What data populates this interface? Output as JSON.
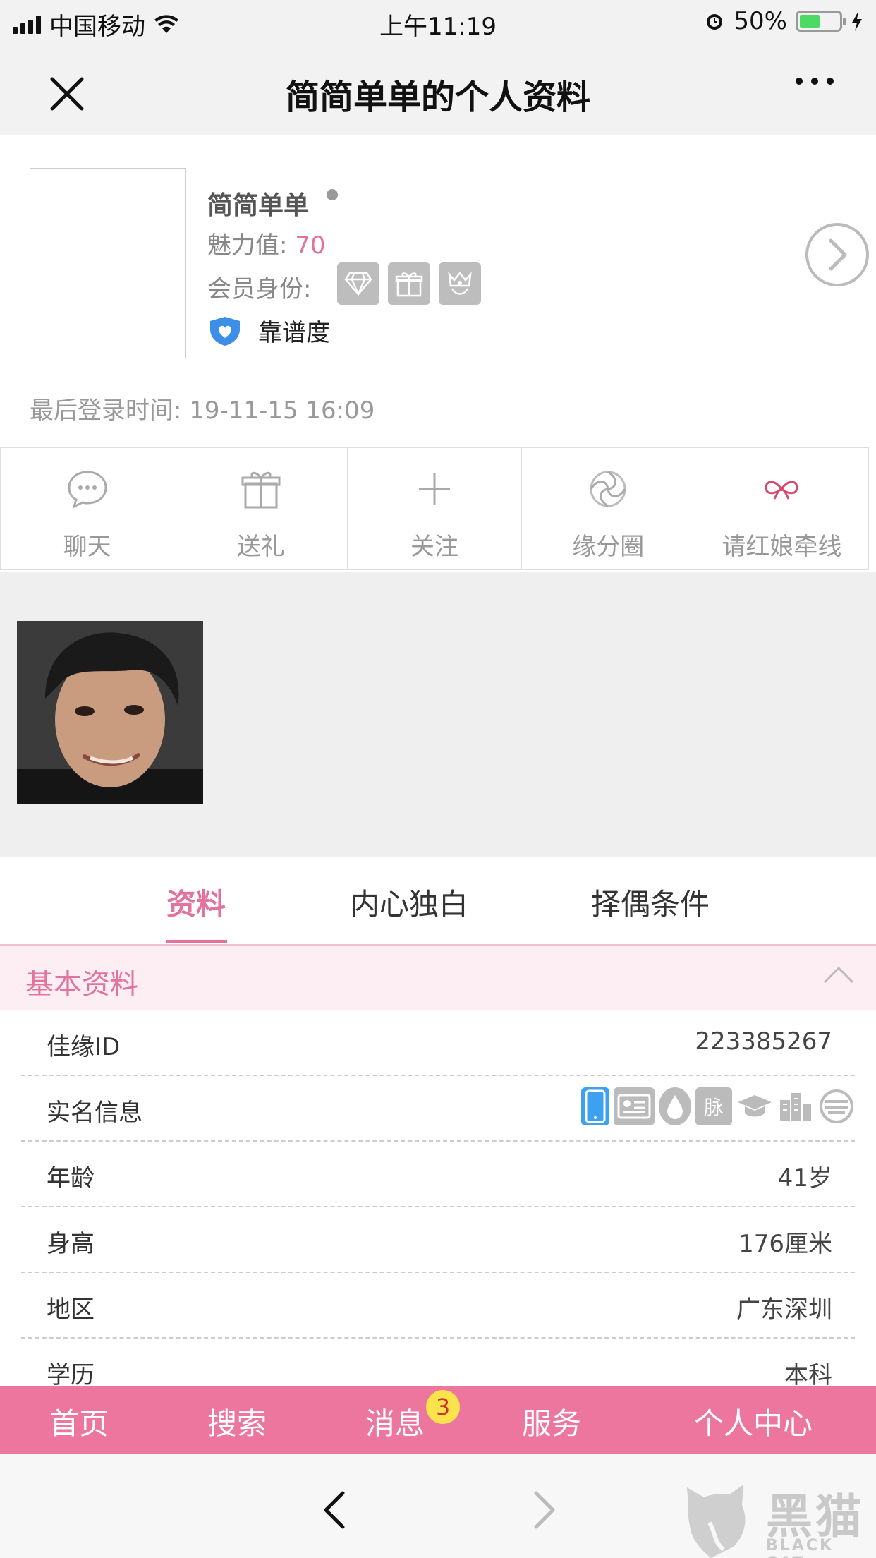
{
  "status_bar": {
    "carrier": "中国移动",
    "time": "上午11:19",
    "battery": "50%"
  },
  "nav": {
    "title": "简简单单的个人资料"
  },
  "profile": {
    "name": "简简单单",
    "charm_label": "魅力值:",
    "charm_value": "70",
    "member_label": "会员身份:",
    "member_icons": [
      "diamond-icon",
      "gift-icon",
      "crown-icon"
    ],
    "reliability_label": "靠谱度",
    "last_login_label": "最后登录时间:",
    "last_login_time": "19-11-15 16:09"
  },
  "actions": [
    {
      "label": "聊天",
      "icon": "chat-icon"
    },
    {
      "label": "送礼",
      "icon": "gift-icon"
    },
    {
      "label": "关注",
      "icon": "plus-icon"
    },
    {
      "label": "缘分圈",
      "icon": "circle-icon"
    },
    {
      "label": "请红娘牵线",
      "icon": "bow-icon"
    }
  ],
  "tabs": [
    {
      "label": "资料",
      "active": true
    },
    {
      "label": "内心独白",
      "active": false
    },
    {
      "label": "择偶条件",
      "active": false
    }
  ],
  "section": {
    "title": "基本资料"
  },
  "info": [
    {
      "key": "佳缘ID",
      "value": "223385267"
    },
    {
      "key": "实名信息",
      "value": ""
    },
    {
      "key": "年龄",
      "value": "41岁"
    },
    {
      "key": "身高",
      "value": "176厘米"
    },
    {
      "key": "地区",
      "value": "广东深圳"
    },
    {
      "key": "学历",
      "value": "本科"
    }
  ],
  "verify_icons": {
    "pulse_text": "脉"
  },
  "bottom_bar": [
    {
      "label": "首页"
    },
    {
      "label": "搜索"
    },
    {
      "label": "消息",
      "badge": "3"
    },
    {
      "label": "服务"
    },
    {
      "label": "个人中心"
    }
  ],
  "watermark": {
    "title": "黑猫",
    "subtitle": "BLACK CAT"
  },
  "colors": {
    "accent": "#e2739d",
    "bottom_bar": "#ec769d",
    "badge": "#fbe34b"
  }
}
